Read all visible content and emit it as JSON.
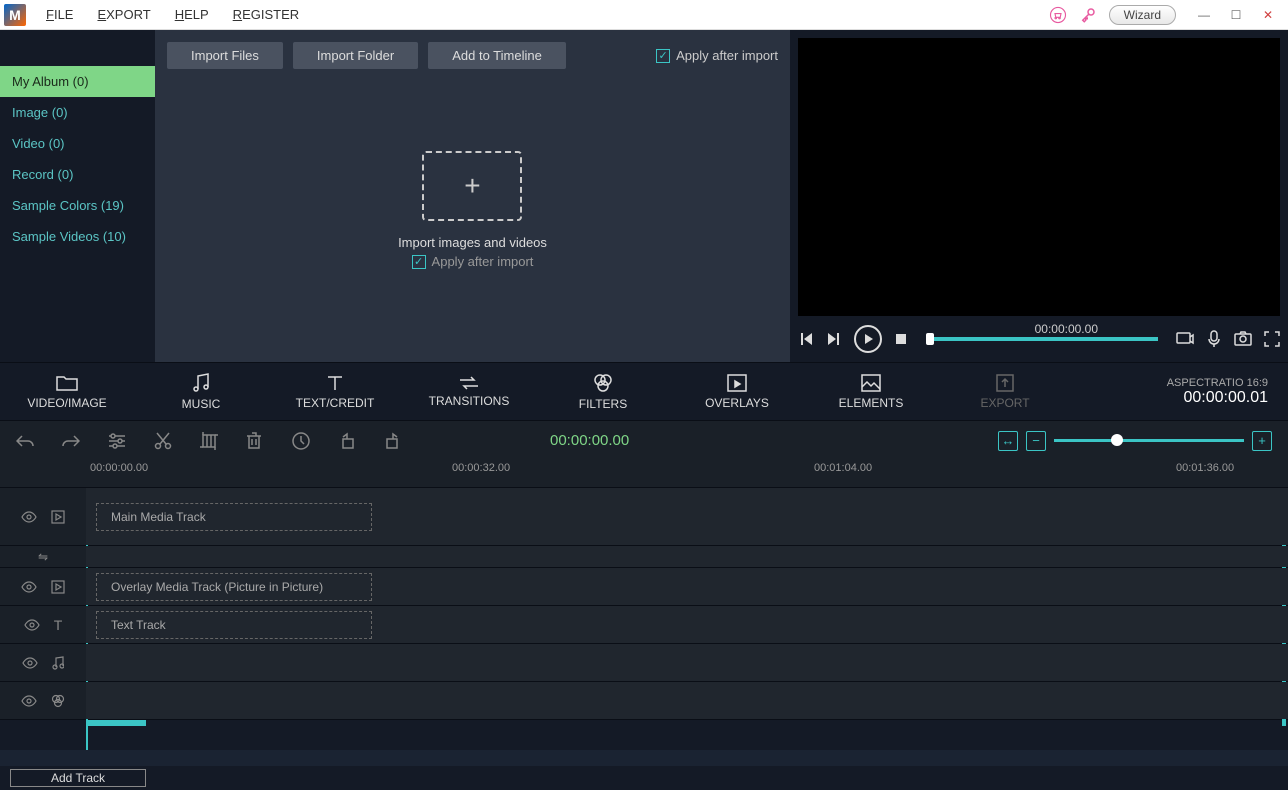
{
  "menu": {
    "file": "FILE",
    "export": "EXPORT",
    "help": "HELP",
    "register": "REGISTER"
  },
  "titlebar": {
    "wizard": "Wizard"
  },
  "sidebar": {
    "items": [
      {
        "label": "My Album (0)",
        "active": true
      },
      {
        "label": "Image (0)"
      },
      {
        "label": "Video (0)"
      },
      {
        "label": "Record (0)"
      },
      {
        "label": "Sample Colors (19)"
      },
      {
        "label": "Sample Videos (10)"
      }
    ]
  },
  "mediaToolbar": {
    "importFiles": "Import Files",
    "importFolder": "Import Folder",
    "addTimeline": "Add to Timeline",
    "applyAfter": "Apply after import"
  },
  "dropZone": {
    "title": "Import images and videos",
    "apply": "Apply after import"
  },
  "preview": {
    "time": "00:00:00.00"
  },
  "tabs": {
    "video": "VIDEO/IMAGE",
    "music": "MUSIC",
    "text": "TEXT/CREDIT",
    "transitions": "TRANSITIONS",
    "filters": "FILTERS",
    "overlays": "OVERLAYS",
    "elements": "ELEMENTS",
    "export": "EXPORT"
  },
  "aspect": {
    "label": "ASPECTRATIO 16:9",
    "time": "00:00:00.01"
  },
  "timeline": {
    "time": "00:00:00.00",
    "ruler": [
      "00:00:00.00",
      "00:00:32.00",
      "00:01:04.00",
      "00:01:36.00"
    ],
    "tracks": {
      "main": "Main Media Track",
      "overlay": "Overlay Media Track (Picture in Picture)",
      "text": "Text Track"
    }
  },
  "footer": {
    "addTrack": "Add Track"
  }
}
